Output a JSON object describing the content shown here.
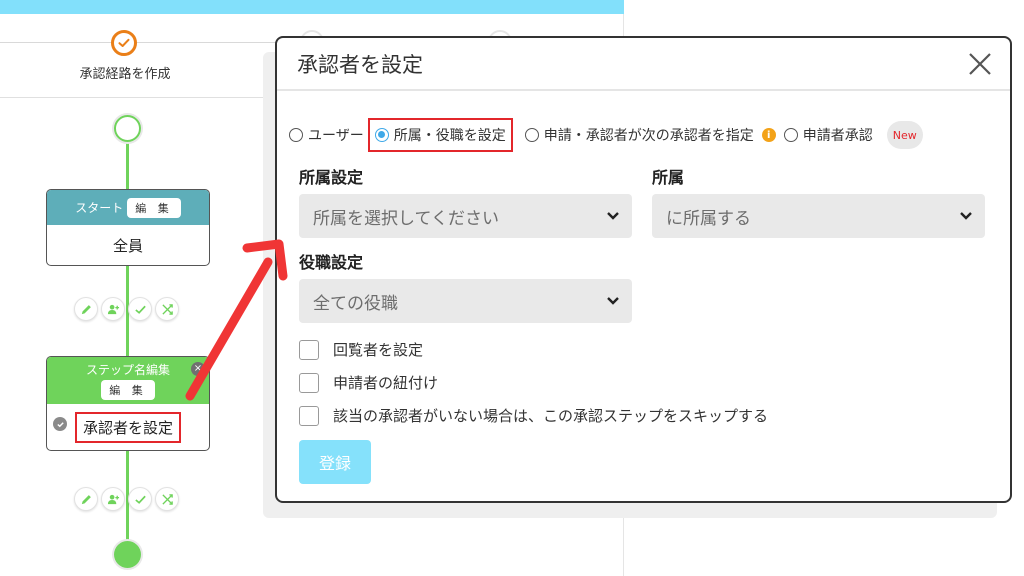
{
  "header": {
    "step_label": "承認経路を作成",
    "step_status_icon": "check-circle-icon"
  },
  "colors": {
    "accent_cyan": "#82e0fb",
    "flow_green": "#6fd35b",
    "start_teal": "#5eaeb9",
    "step_orange": "#ea7f18",
    "highlight_red": "#e3262b",
    "radio_blue": "#3fa9e8",
    "info_orange": "#f3a218"
  },
  "flow": {
    "start_node": {
      "title": "スタート",
      "edit_label": "編 集",
      "body": "全員"
    },
    "step_node": {
      "title": "ステップ名編集",
      "edit_label": "編 集",
      "body": "承認者を設定",
      "close_icon": "×"
    },
    "actions": [
      {
        "icon": "pencil-icon",
        "label": "edit"
      },
      {
        "icon": "user-add-icon",
        "label": "add-user"
      },
      {
        "icon": "check-icon",
        "label": "approve"
      },
      {
        "icon": "shuffle-icon",
        "label": "branch"
      }
    ]
  },
  "dialog": {
    "title": "承認者を設定",
    "close_icon": "close-icon",
    "radio_options": [
      {
        "label": "ユーザー",
        "checked": false
      },
      {
        "label": "所属・役職を設定",
        "checked": true
      },
      {
        "label": "申請・承認者が次の承認者を指定",
        "checked": false
      },
      {
        "label": "申請者承認",
        "checked": false
      }
    ],
    "info_icon": "i",
    "new_badge": "New",
    "affiliation_setting": {
      "label": "所属設定",
      "placeholder": "所属を選択してください"
    },
    "affiliation": {
      "label": "所属",
      "value": "に所属する"
    },
    "position_setting": {
      "label": "役職設定",
      "value": "全ての役職"
    },
    "checkboxes": [
      {
        "label": "回覧者を設定",
        "checked": false
      },
      {
        "label": "申請者の紐付け",
        "checked": false
      },
      {
        "label": "該当の承認者がいない場合は、この承認ステップをスキップする",
        "checked": false
      }
    ],
    "submit_label": "登録"
  }
}
